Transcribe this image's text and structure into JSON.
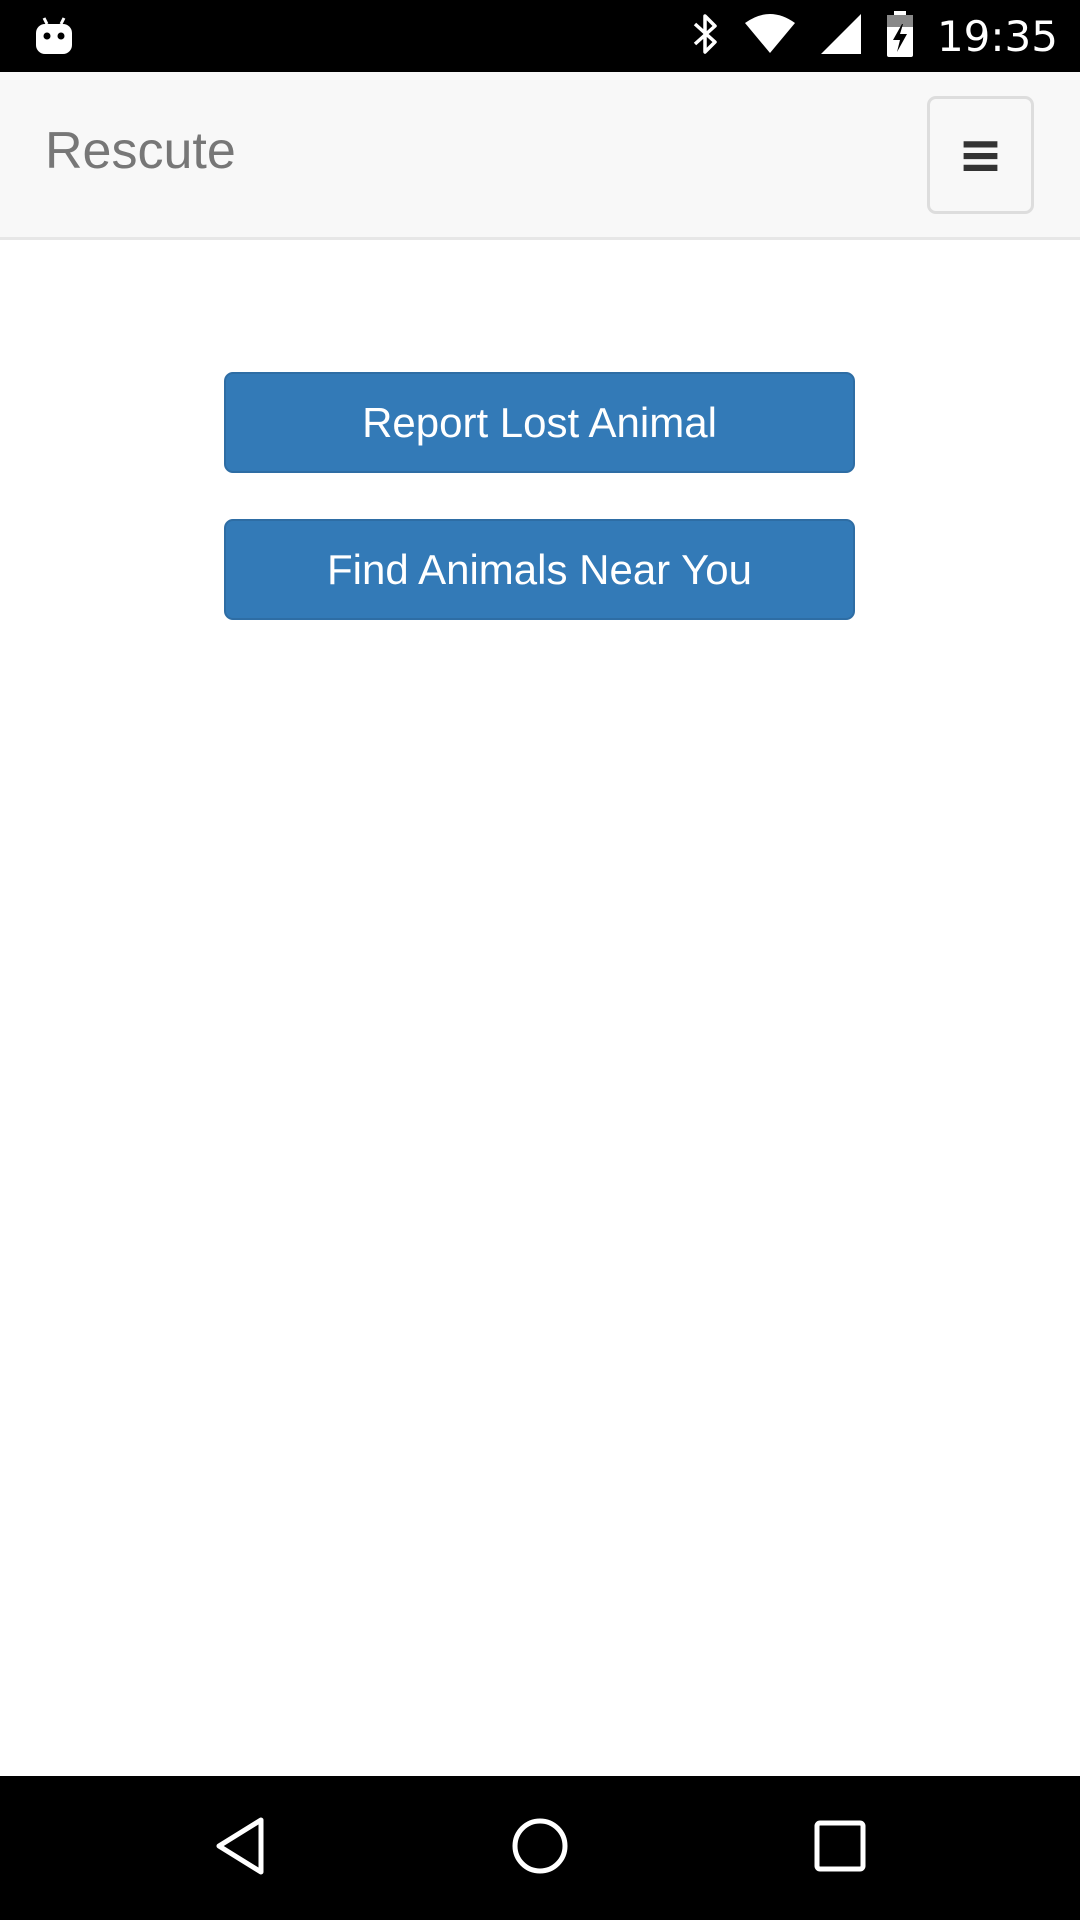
{
  "status_bar": {
    "time": "19:35",
    "icons": [
      "android-debug-icon",
      "bluetooth-icon",
      "wifi-icon",
      "cell-signal-icon",
      "battery-charging-icon"
    ]
  },
  "navbar": {
    "brand": "Rescute",
    "menu_icon": "hamburger-menu-icon",
    "menu_glyph": "≡"
  },
  "main": {
    "buttons": [
      {
        "label": "Report Lost Animal"
      },
      {
        "label": "Find Animals Near You"
      }
    ]
  },
  "nav_bar": {
    "icons": [
      "back-icon",
      "home-icon",
      "recents-icon"
    ]
  },
  "colors": {
    "primary_button": "#337ab7",
    "navbar_bg": "#f8f8f8",
    "brand_text": "#777777"
  }
}
